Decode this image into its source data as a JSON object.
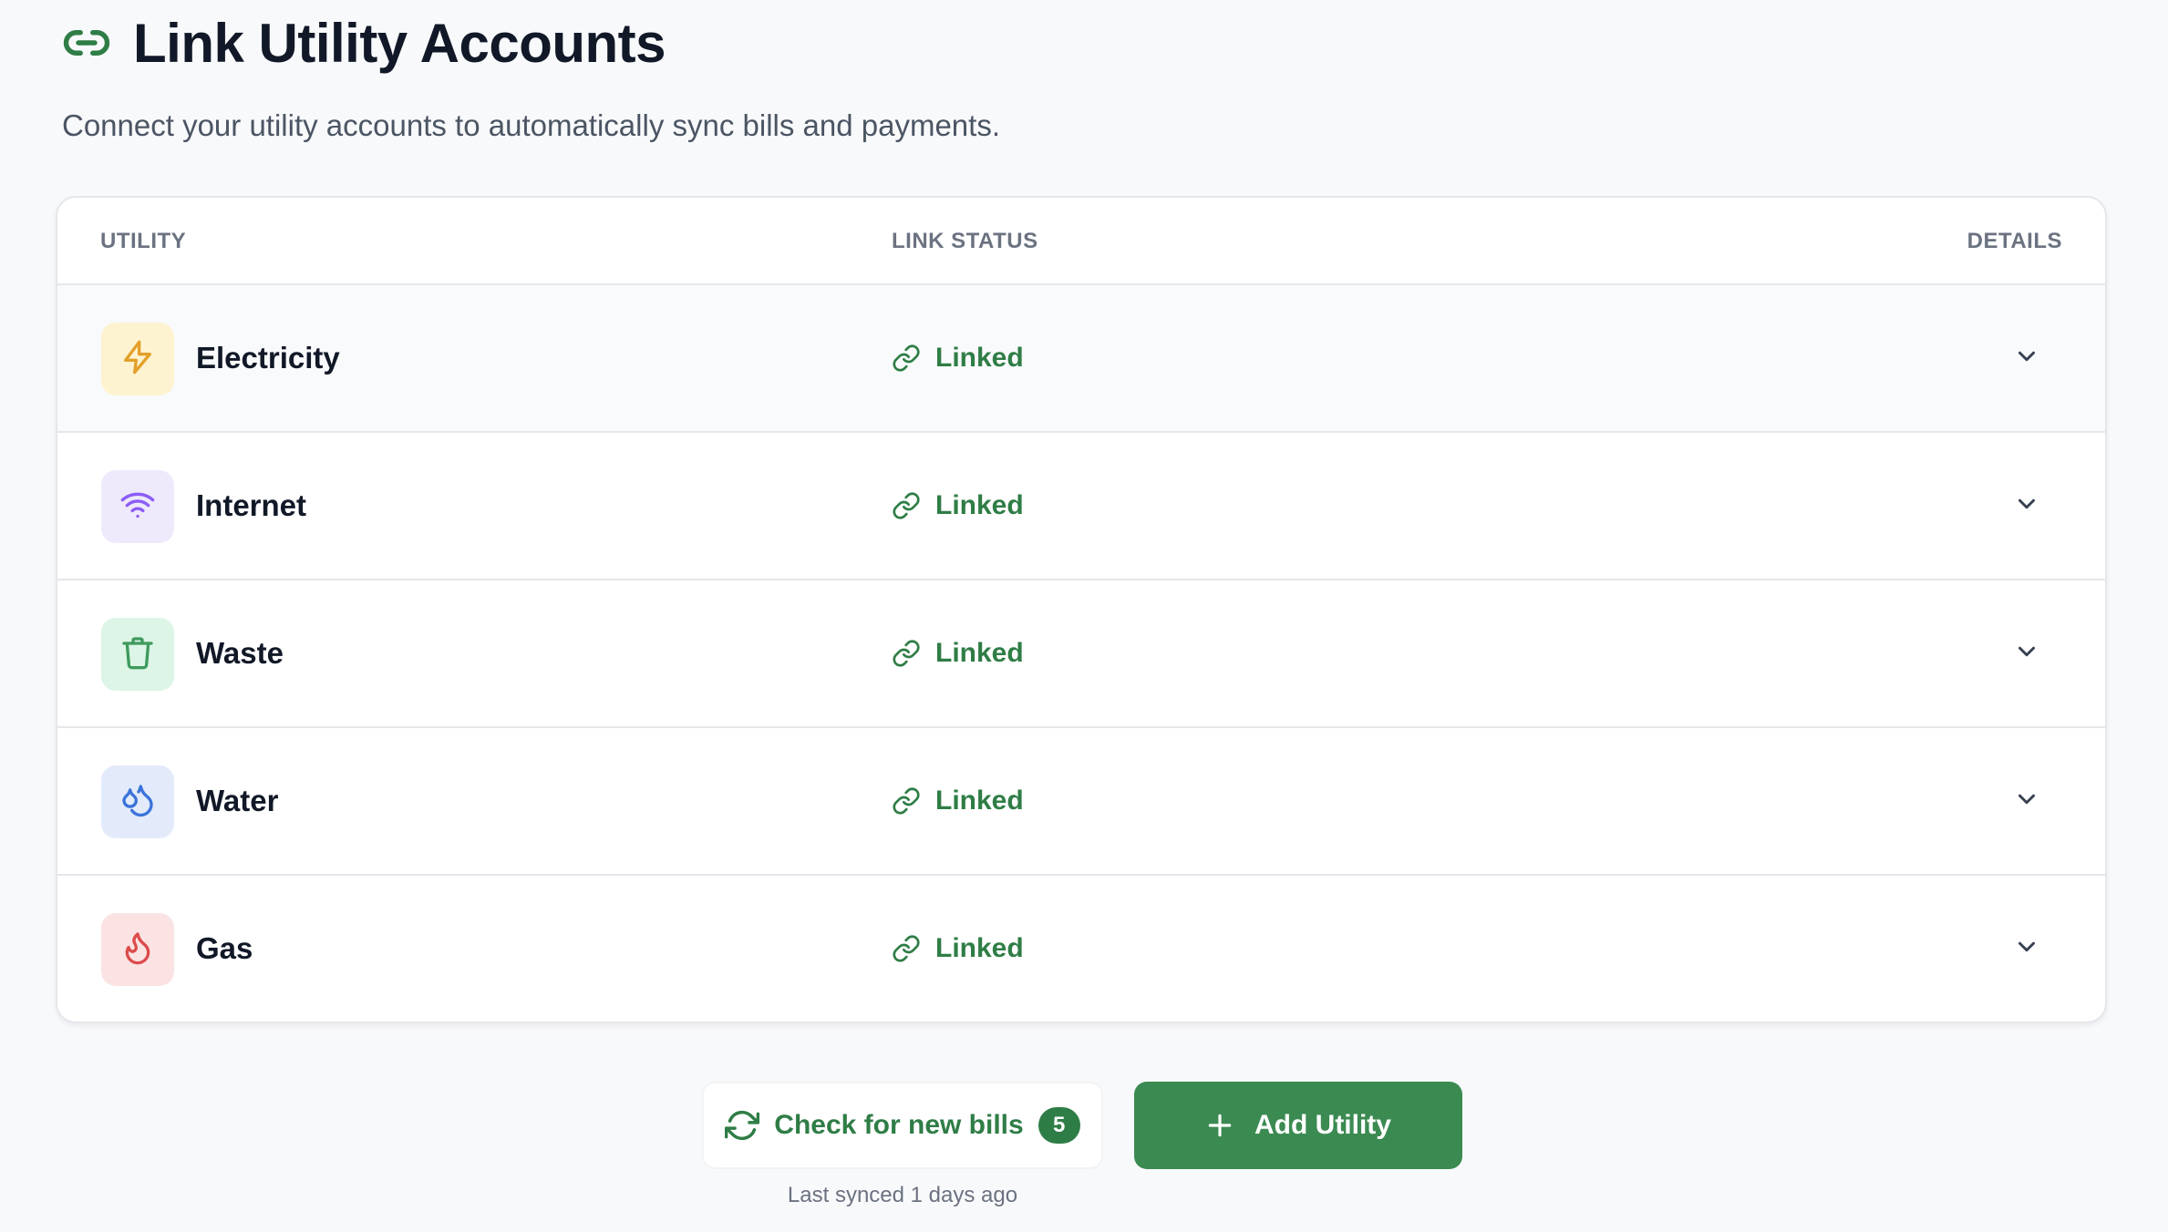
{
  "header": {
    "icon": "link-icon",
    "title": "Link Utility Accounts",
    "subtitle": "Connect your utility accounts to automatically sync bills and payments."
  },
  "table": {
    "columns": [
      "UTILITY",
      "LINK STATUS",
      "DETAILS"
    ],
    "rows": [
      {
        "name": "Electricity",
        "icon": "lightning-bolt-icon",
        "icon_bg": "#fdf3d0",
        "icon_color": "#e3a02a",
        "status": "Linked",
        "status_icon": "link-icon"
      },
      {
        "name": "Internet",
        "icon": "wifi-icon",
        "icon_bg": "#efe9fc",
        "icon_color": "#8b5cf6",
        "status": "Linked",
        "status_icon": "link-icon"
      },
      {
        "name": "Waste",
        "icon": "trash-icon",
        "icon_bg": "#dcf5e6",
        "icon_color": "#3f9a5d",
        "status": "Linked",
        "status_icon": "link-icon"
      },
      {
        "name": "Water",
        "icon": "water-drops-icon",
        "icon_bg": "#e3ebfb",
        "icon_color": "#3b73d9",
        "status": "Linked",
        "status_icon": "link-icon"
      },
      {
        "name": "Gas",
        "icon": "flame-icon",
        "icon_bg": "#fbe3e3",
        "icon_color": "#dc4b4b",
        "status": "Linked",
        "status_icon": "link-icon"
      }
    ]
  },
  "actions": {
    "check_label": "Check for new bills",
    "check_badge": "5",
    "add_label": "Add Utility",
    "last_synced": "Last synced 1 days ago"
  },
  "colors": {
    "accent_green": "#2f7d46",
    "button_green": "#3b8a52",
    "border": "#e5e7eb",
    "background": "#f8f9fb"
  }
}
